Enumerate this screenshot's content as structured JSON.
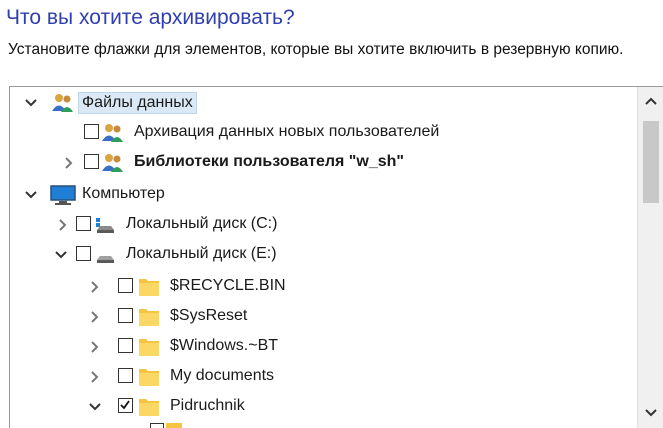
{
  "heading": "Что вы хотите архивировать?",
  "description": "Установите флажки для элементов, которые вы хотите включить в резервную копию.",
  "tree": [
    {
      "label": "Файлы данных",
      "icon": "users-icon",
      "expander": "expanded",
      "checkbox": false,
      "selected": true,
      "bold": false
    },
    {
      "label": "Архивация данных новых пользователей",
      "icon": "users-icon",
      "expander": "none",
      "checkbox": true,
      "checked": false,
      "bold": false
    },
    {
      "label": "Библиотеки пользователя \"w_sh\"",
      "icon": "users-icon",
      "expander": "collapsed",
      "checkbox": true,
      "checked": false,
      "bold": true
    },
    {
      "label": "Компьютер",
      "icon": "computer-icon",
      "expander": "expanded",
      "checkbox": false,
      "bold": false
    },
    {
      "label": "Локальный диск (C:)",
      "icon": "system-drive-icon",
      "expander": "collapsed",
      "checkbox": true,
      "checked": false,
      "bold": false
    },
    {
      "label": "Локальный диск (E:)",
      "icon": "drive-icon",
      "expander": "expanded",
      "checkbox": true,
      "checked": false,
      "bold": false
    },
    {
      "label": "$RECYCLE.BIN",
      "icon": "folder-icon",
      "expander": "collapsed",
      "checkbox": true,
      "checked": false,
      "bold": false
    },
    {
      "label": "$SysReset",
      "icon": "folder-icon",
      "expander": "collapsed",
      "checkbox": true,
      "checked": false,
      "bold": false
    },
    {
      "label": "$Windows.~BT",
      "icon": "folder-icon",
      "expander": "collapsed",
      "checkbox": true,
      "checked": false,
      "bold": false
    },
    {
      "label": "My documents",
      "icon": "folder-icon",
      "expander": "collapsed",
      "checkbox": true,
      "checked": false,
      "bold": false
    },
    {
      "label": "Pidruchnik",
      "icon": "folder-icon",
      "expander": "expanded",
      "checkbox": true,
      "checked": true,
      "bold": false
    }
  ],
  "scrollbar": {
    "up_icon": "chevron-up-icon",
    "down_icon": "chevron-down-icon"
  }
}
